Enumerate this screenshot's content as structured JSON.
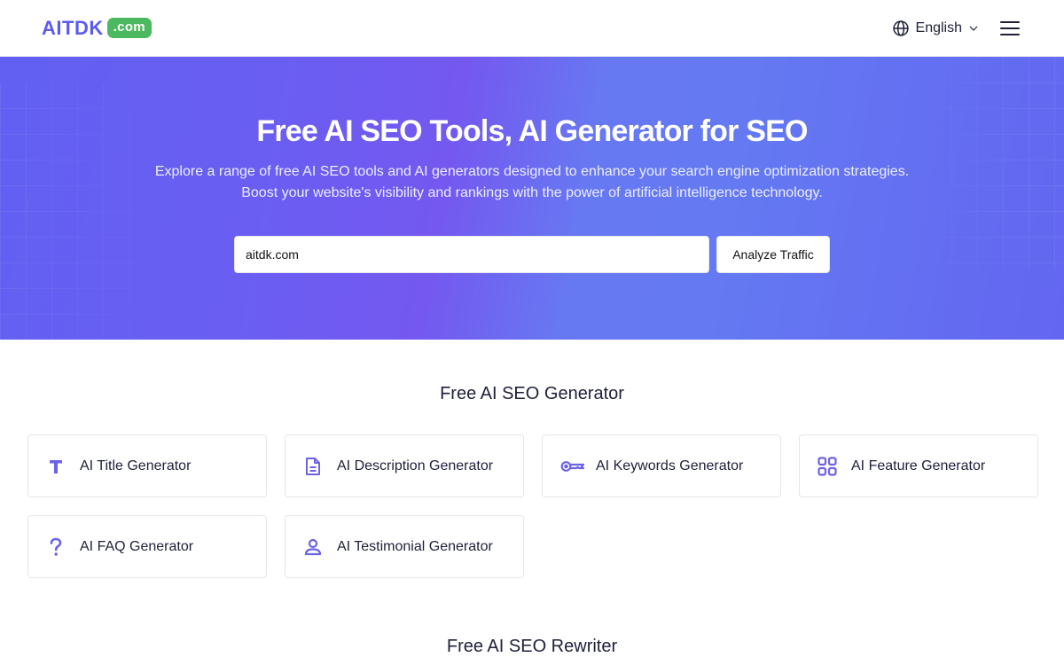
{
  "header": {
    "logo_text": "AITDK",
    "logo_badge": ".com",
    "language": "English"
  },
  "hero": {
    "title": "Free AI SEO Tools, AI Generator for SEO",
    "description_line1": "Explore a range of free AI SEO tools and AI generators designed to enhance your search engine optimization strategies.",
    "description_line2": "Boost your website's visibility and rankings with the power of artificial intelligence technology.",
    "input_value": "aitdk.com",
    "button_label": "Analyze Traffic"
  },
  "generator_section": {
    "title": "Free AI SEO Generator",
    "items": [
      {
        "label": "AI Title Generator",
        "icon": "title-icon"
      },
      {
        "label": "AI Description Generator",
        "icon": "document-icon"
      },
      {
        "label": "AI Keywords Generator",
        "icon": "key-icon"
      },
      {
        "label": "AI Feature Generator",
        "icon": "grid-icon"
      },
      {
        "label": "AI FAQ Generator",
        "icon": "question-icon"
      },
      {
        "label": "AI Testimonial Generator",
        "icon": "user-icon"
      }
    ]
  },
  "rewriter_section": {
    "title": "Free AI SEO Rewriter"
  },
  "colors": {
    "brand": "#5b5bf0",
    "badge": "#4cb860",
    "icon_accent": "#6b63e6"
  }
}
